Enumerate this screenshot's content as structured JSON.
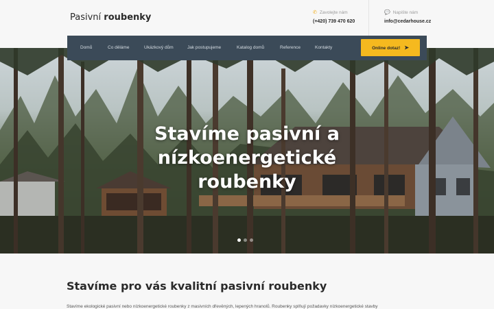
{
  "logo": {
    "light": "Pasivní",
    "bold": "roubenky"
  },
  "contacts": {
    "phone": {
      "label": "Zavolejte nám",
      "value": "(+420) 739 470 620",
      "icon": "phone-icon"
    },
    "email": {
      "label": "Napište nám",
      "value": "info@cedarhouse.cz",
      "icon": "chat-icon"
    }
  },
  "nav": {
    "items": [
      "Domů",
      "Co děláme",
      "Ukázkový dům",
      "Jak postupujeme",
      "Katalog domů",
      "Reference",
      "Kontakty"
    ],
    "cta": "Online dotaz!"
  },
  "hero": {
    "title_line1": "Stavíme pasivní a nízkoenergetické",
    "title_line2": "roubenky",
    "slides": 3,
    "active_slide": 1
  },
  "section": {
    "heading": "Stavíme pro vás kvalitní pasivní roubenky",
    "text": "Stavíme ekologické pasivní nebo nízkoenergetické roubenky z masivních dřevěných, lepených hranolů. Roubenky splňují požadavky nízkoenergetické stavby"
  },
  "colors": {
    "accent": "#f5b91f",
    "nav_bg": "#3b4a58",
    "text": "#2a2a2a"
  }
}
